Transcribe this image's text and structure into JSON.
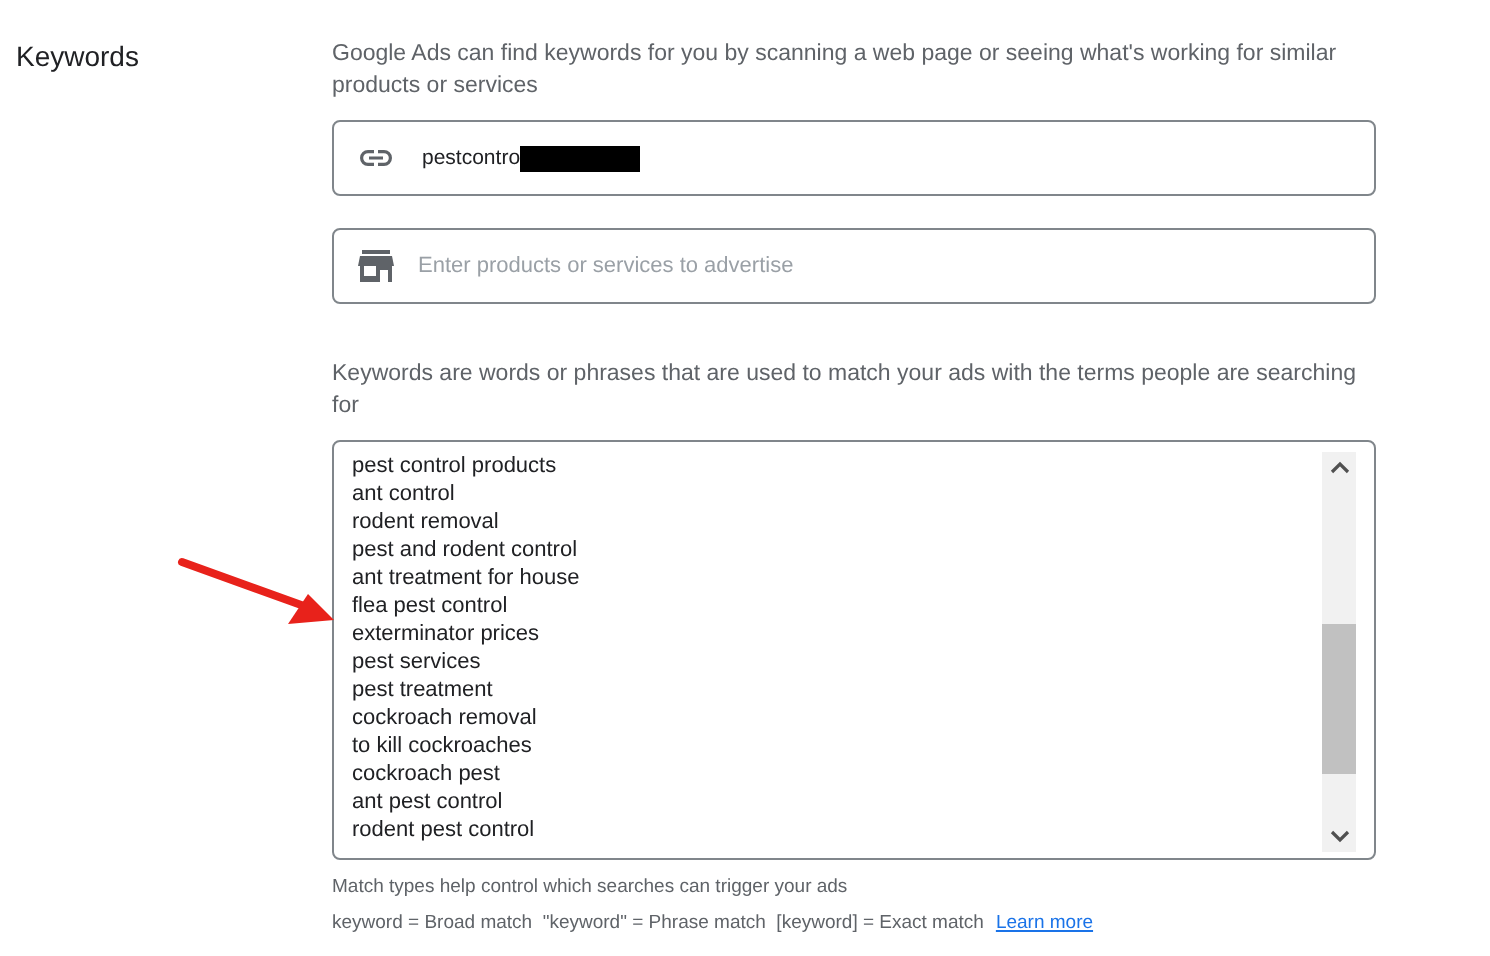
{
  "section": {
    "title": "Keywords"
  },
  "intro": "Google Ads can find keywords for you by scanning a web page or seeing what's working for similar products or services",
  "url_field": {
    "value": "pestcontro",
    "redacted": true
  },
  "product_field": {
    "placeholder": "Enter products or services to advertise"
  },
  "keywords_help": "Keywords are words or phrases that are used to match your ads with the terms people are searching for",
  "keywords": [
    "pest control products",
    "ant control",
    "rodent removal",
    "pest and rodent control",
    "ant treatment for house",
    "flea pest control",
    "exterminator prices",
    "pest services",
    "pest treatment",
    "cockroach removal",
    "to kill cockroaches",
    "cockroach pest",
    "ant pest control",
    "rodent pest control"
  ],
  "match_help": "Match types help control which searches can trigger your ads",
  "match_types": "keyword = Broad match  \"keyword\" = Phrase match  [keyword] = Exact match",
  "learn_more": "Learn more"
}
